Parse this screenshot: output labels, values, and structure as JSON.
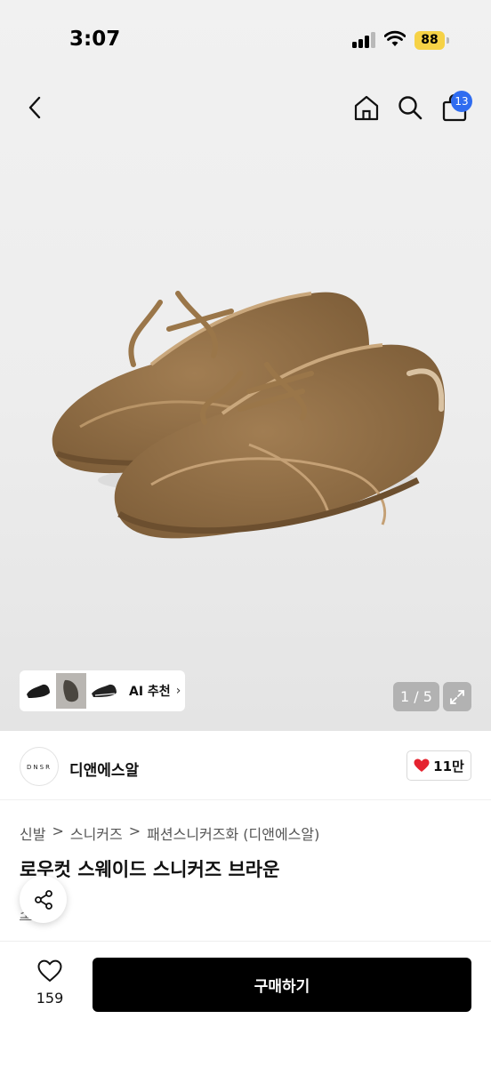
{
  "status_bar": {
    "time": "3:07",
    "battery": "88"
  },
  "header": {
    "back_icon": "chevron-left-icon",
    "home_icon": "home-icon",
    "search_icon": "search-icon",
    "bag_icon": "shopping-bag-icon",
    "cart_count": "13"
  },
  "gallery": {
    "ai_label": "AI 추천",
    "ai_arrow": "›",
    "page_indicator": "1 / 5",
    "expand_icon": "expand-icon",
    "thumbnails": [
      "shoe-thumb-black",
      "shoe-thumb-dark-grey",
      "shoe-thumb-black-side"
    ]
  },
  "shop": {
    "logo_text": "DNSR",
    "name": "디앤에스알",
    "likes": "11만"
  },
  "breadcrumb": [
    "신발",
    "스니커즈",
    "패션스니커즈화 (디앤에스알)"
  ],
  "breadcrumb_separator": ">",
  "product": {
    "title": "로우컷 스웨이드 스니커즈 브라운",
    "sub_link": "소개"
  },
  "bottom_bar": {
    "wish_count": "159",
    "buy_label": "구매하기"
  },
  "colors": {
    "badge": "#2f6cf0",
    "battery": "#f6d246",
    "heart": "#e5232f",
    "buy_button": "#000000",
    "shoe": "#8b6b44"
  }
}
